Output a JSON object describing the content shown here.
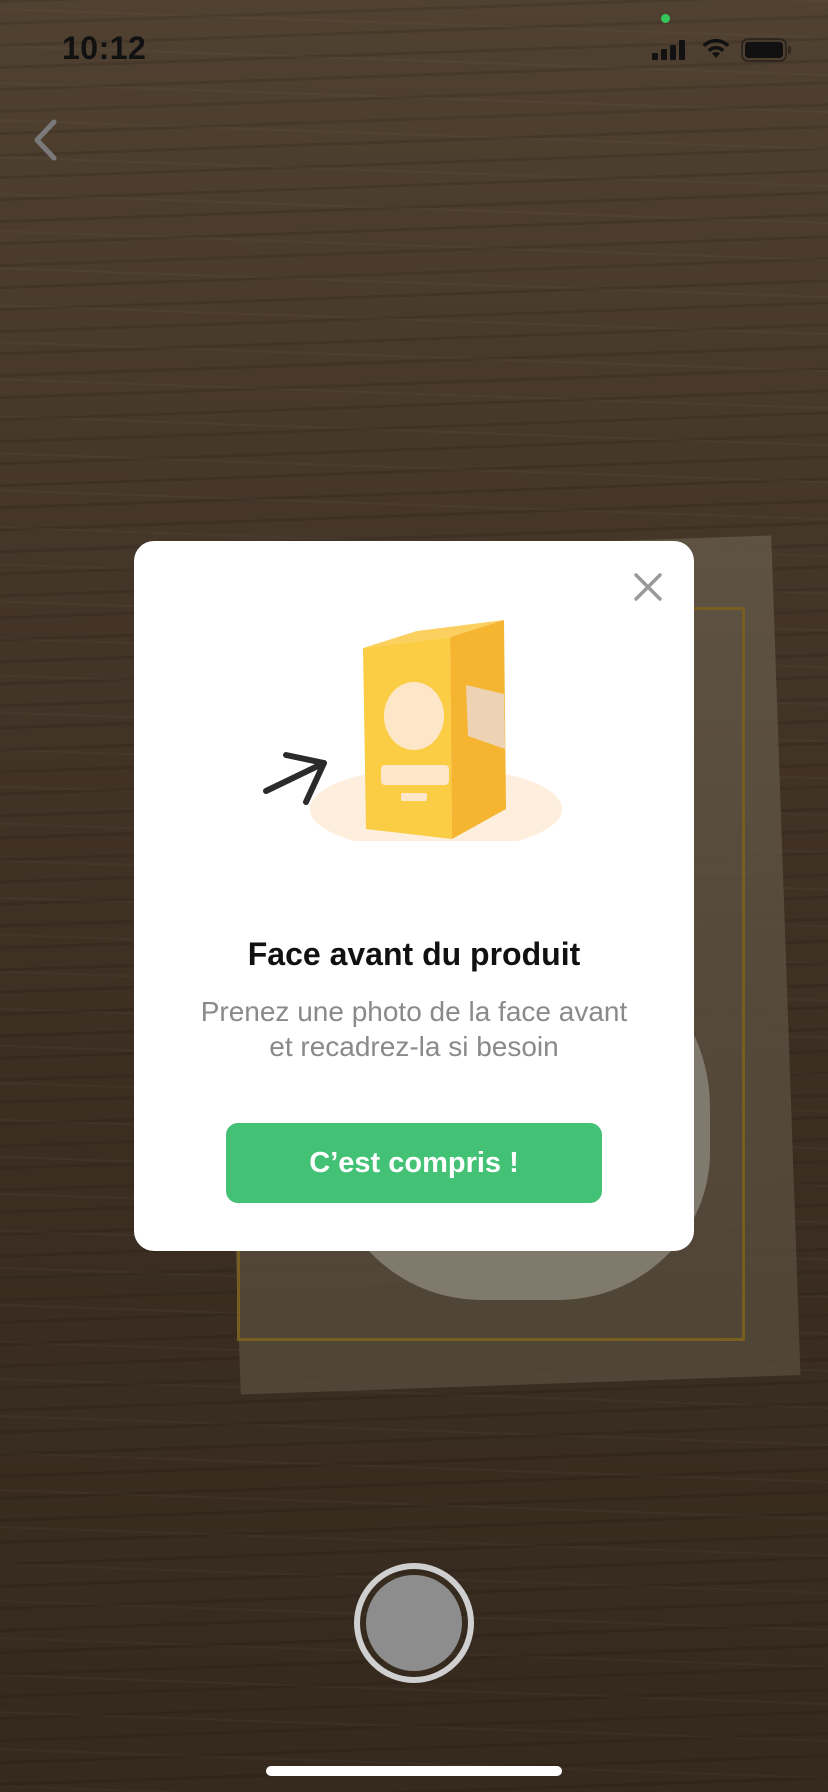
{
  "status_bar": {
    "time": "10:12",
    "icons": [
      "signal-icon",
      "wifi-icon",
      "battery-icon"
    ],
    "privacy_dot_color": "#35c759"
  },
  "navigation": {
    "back_icon": "chevron-left-icon"
  },
  "modal": {
    "close_icon": "close-icon",
    "illustration": "product-box-front-illustration",
    "title": "Face avant du produit",
    "description_line1": "Prenez une photo de la face avant",
    "description_line2": "et recadrez-la si besoin",
    "confirm_label": "C’est compris !"
  },
  "camera": {
    "shutter_icon": "shutter-button"
  },
  "colors": {
    "accent": "#43c276",
    "crop_frame": "#a5822b",
    "box_yellow": "#fbc63b"
  }
}
